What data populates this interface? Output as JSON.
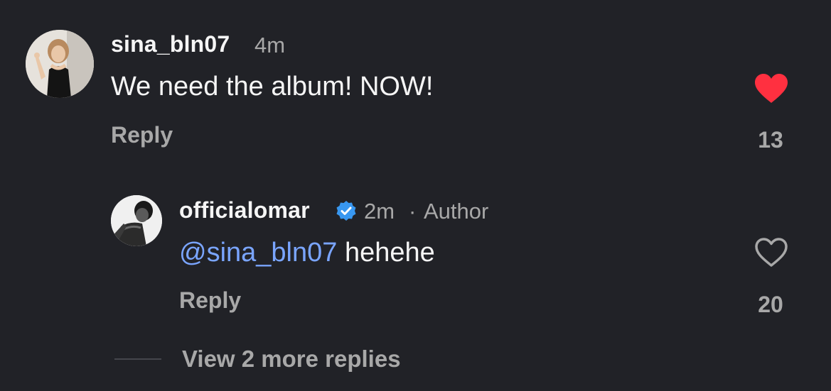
{
  "comment": {
    "username": "sina_bln07",
    "time": "4m",
    "text": "We need the album! NOW!",
    "reply_label": "Reply",
    "likes": "13",
    "liked": true,
    "like_color": "#ff3040"
  },
  "reply": {
    "username": "officialomar",
    "verified": true,
    "time": "2m",
    "separator": "·",
    "role": "Author",
    "mention": "@sina_bln07",
    "text": "hehehe",
    "reply_label": "Reply",
    "likes": "20",
    "liked": false
  },
  "view_more": {
    "label": "View 2 more replies"
  },
  "colors": {
    "background": "#212227",
    "text": "#f5f5f5",
    "muted": "#a8a8a8",
    "mention": "#7aa5ff",
    "verified": "#3897f0"
  }
}
